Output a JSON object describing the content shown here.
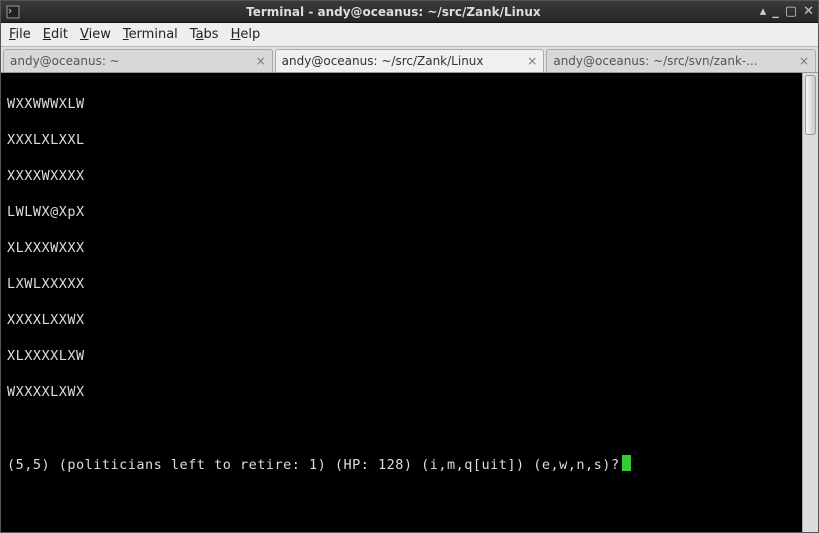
{
  "titlebar": {
    "title": "Terminal - andy@oceanus: ~/src/Zank/Linux"
  },
  "menubar": {
    "file": "File",
    "edit": "Edit",
    "view": "View",
    "terminal": "Terminal",
    "tabs": "Tabs",
    "help": "Help"
  },
  "tabs": [
    {
      "label": "andy@oceanus: ~",
      "active": false
    },
    {
      "label": "andy@oceanus: ~/src/Zank/Linux",
      "active": true
    },
    {
      "label": "andy@oceanus: ~/src/svn/zank-...",
      "active": false
    }
  ],
  "terminal": {
    "map": [
      "WXXWWWXLW",
      "XXXLXLXXL",
      "XXXXWXXXX",
      "LWLWX@XpX",
      "XLXXXWXXX",
      "LXWLXXXXX",
      "XXXXLXXWX",
      "XLXXXXLXW",
      "WXXXXLXWX"
    ],
    "status": "(5,5) (politicians left to retire: 1) (HP: 128) (i,m,q[uit]) (e,w,n,s)?"
  }
}
